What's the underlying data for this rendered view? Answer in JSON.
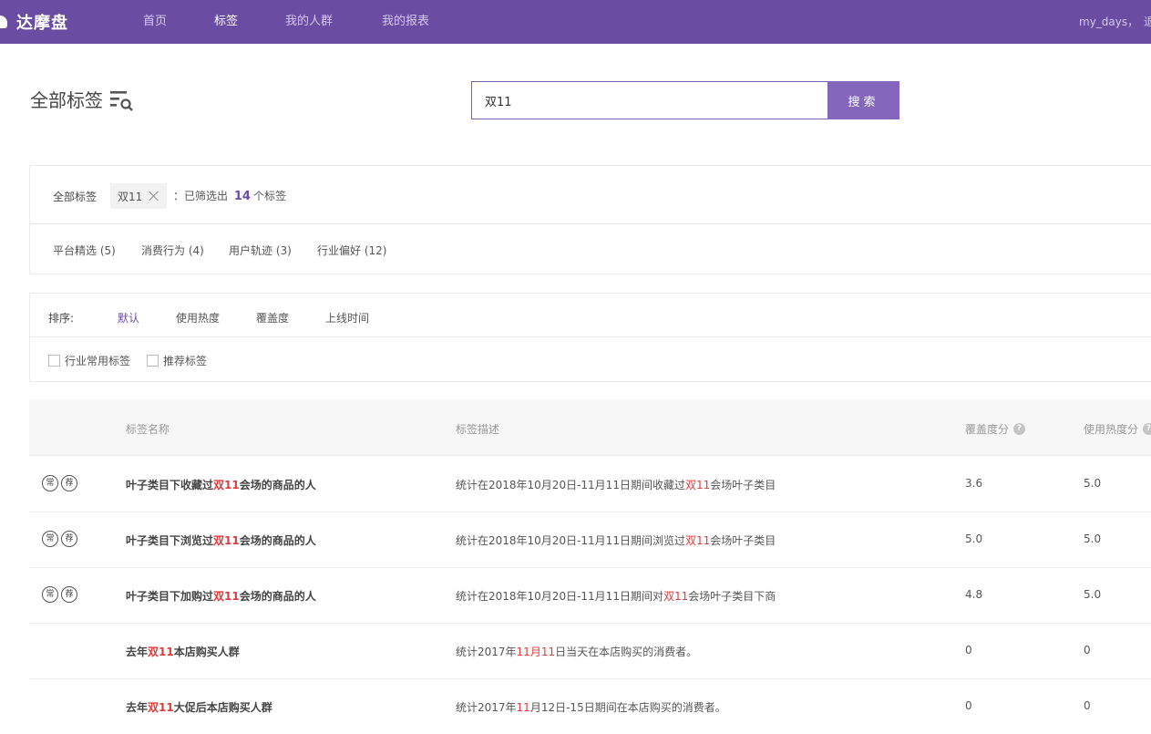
{
  "nav": {
    "brand": "达摩盘",
    "items": [
      {
        "label": "首页",
        "active": false
      },
      {
        "label": "标签",
        "active": true
      },
      {
        "label": "我的人群",
        "active": false
      },
      {
        "label": "我的报表",
        "active": false
      }
    ],
    "user": "my_days，",
    "logout": "退出"
  },
  "page": {
    "title": "全部标签"
  },
  "search": {
    "value": "双11",
    "button": "搜索"
  },
  "filter": {
    "label": "全部标签",
    "chip": "双11",
    "result_prefix": "：已筛选出",
    "result_count": "14",
    "result_suffix": "个标签",
    "categories": [
      "平台精选 (5)",
      "消费行为 (4)",
      "用户轨迹 (3)",
      "行业偏好 (12)"
    ]
  },
  "sort": {
    "label": "排序:",
    "options": [
      {
        "label": "默认",
        "active": true
      },
      {
        "label": "使用热度",
        "active": false
      },
      {
        "label": "覆盖度",
        "active": false
      },
      {
        "label": "上线时间",
        "active": false
      }
    ],
    "checks": [
      "行业常用标签",
      "推荐标签"
    ]
  },
  "table": {
    "headers": {
      "name": "标签名称",
      "desc": "标签描述",
      "coverage": "覆盖度分",
      "heat": "使用热度分"
    },
    "help_glyph": "?",
    "badge_common": "常",
    "badge_recommend": "荐",
    "rows": [
      {
        "badges": true,
        "name_pre": "叶子类目下收藏过",
        "name_hl": "双11",
        "name_post": "会场的商品的人",
        "desc_pre": "统计在2018年10月20日-11月11日期间收藏过",
        "desc_hl": "双11",
        "desc_post": "会场叶子类目",
        "coverage": "3.6",
        "heat": "5.0"
      },
      {
        "badges": true,
        "name_pre": "叶子类目下浏览过",
        "name_hl": "双11",
        "name_post": "会场的商品的人",
        "desc_pre": "统计在2018年10月20日-11月11日期间浏览过",
        "desc_hl": "双11",
        "desc_post": "会场叶子类目",
        "coverage": "5.0",
        "heat": "5.0"
      },
      {
        "badges": true,
        "name_pre": "叶子类目下加购过",
        "name_hl": "双11",
        "name_post": "会场的商品的人",
        "desc_pre": "统计在2018年10月20日-11月11日期间对",
        "desc_hl": "双11",
        "desc_post": "会场叶子类目下商",
        "coverage": "4.8",
        "heat": "5.0"
      },
      {
        "badges": false,
        "name_pre": "去年",
        "name_hl": "双11",
        "name_post": "本店购买人群",
        "desc_pre": "统计2017年",
        "desc_hl": "11月11",
        "desc_post": "日当天在本店购买的消费者。",
        "coverage": "0",
        "heat": "0"
      },
      {
        "badges": false,
        "name_pre": "去年",
        "name_hl": "双11",
        "name_post": "大促后本店购买人群",
        "desc_pre": "统计2017年",
        "desc_hl": "11",
        "desc_post": "月12日-15日期间在本店购买的消费者。",
        "coverage": "0",
        "heat": "0"
      }
    ]
  },
  "colors": {
    "brand": "#6a4ca3",
    "button": "#8566bd",
    "highlight": "#e03a3a"
  },
  "icons": {
    "title": "filter-search-icon",
    "chip_close": "close-icon",
    "help": "help-icon"
  }
}
